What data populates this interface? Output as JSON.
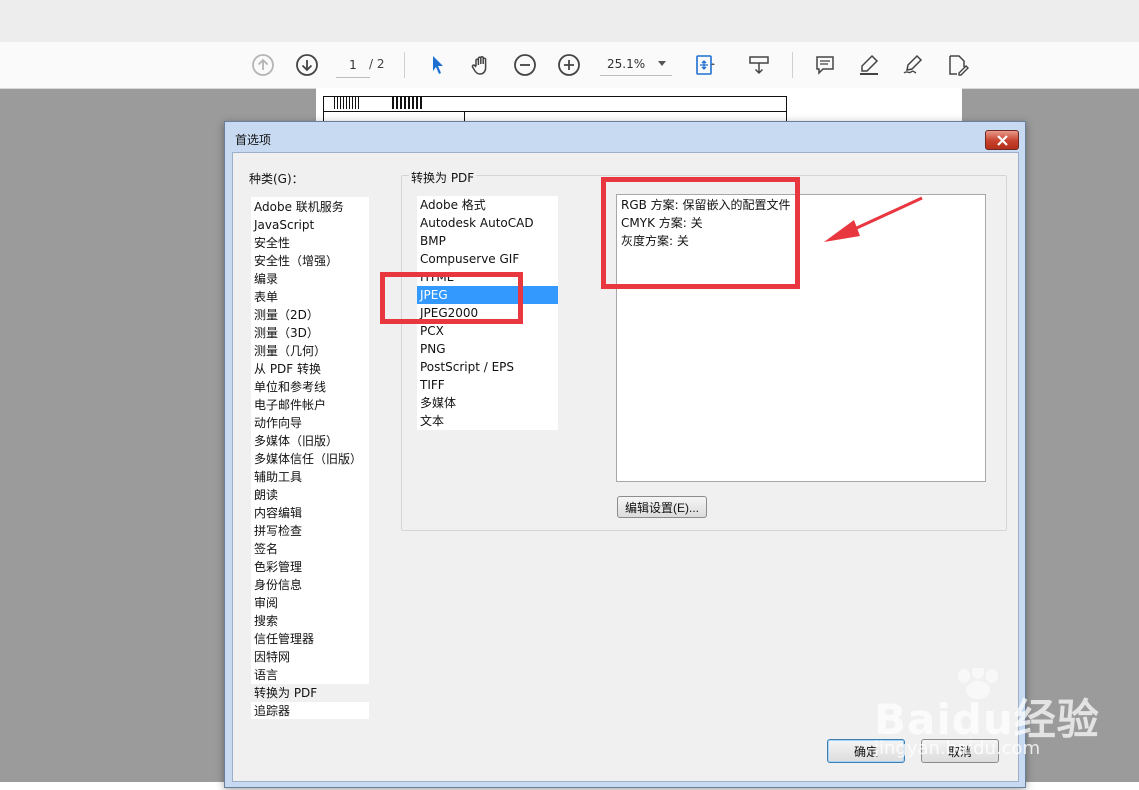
{
  "toolbar": {
    "page_current": "1",
    "page_total": "/ 2",
    "zoom": "25.1%"
  },
  "dialog": {
    "title": "首选项",
    "categories_label": "种类(G)：",
    "categories": [
      "Adobe 联机服务",
      "JavaScript",
      "安全性",
      "安全性（增强）",
      "编录",
      "表单",
      "测量（2D）",
      "测量（3D）",
      "测量（几何）",
      "从 PDF 转换",
      "单位和参考线",
      "电子邮件帐户",
      "动作向导",
      "多媒体（旧版）",
      "多媒体信任（旧版）",
      "辅助工具",
      "朗读",
      "内容编辑",
      "拼写检查",
      "签名",
      "色彩管理",
      "身份信息",
      "审阅",
      "搜索",
      "信任管理器",
      "因特网",
      "语言",
      "转换为 PDF",
      "追踪器"
    ],
    "selected_category": "转换为 PDF",
    "group_title": "转换为 PDF",
    "formats": [
      "Adobe 格式",
      "Autodesk AutoCAD",
      "BMP",
      "Compuserve GIF",
      "HTML",
      "JPEG",
      "JPEG2000",
      "PCX",
      "PNG",
      "PostScript / EPS",
      "TIFF",
      "多媒体",
      "文本"
    ],
    "selected_format": "JPEG",
    "info_lines": [
      "RGB 方案: 保留嵌入的配置文件",
      "CMYK 方案: 关",
      "灰度方案: 关"
    ],
    "edit_settings_label": "编辑设置(E)...",
    "ok_label": "确定",
    "cancel_label": "取消"
  },
  "watermark": {
    "brand": "Baidu经验",
    "url": "jingyan.baidu.com"
  },
  "colors": {
    "selection": "#3399ff",
    "annotation": "#e8373f",
    "dialog_frame": "#c8daf2"
  }
}
